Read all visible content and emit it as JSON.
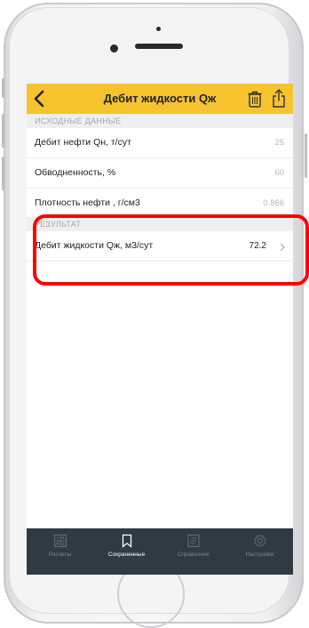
{
  "header": {
    "title": "Дебит жидкости Qж",
    "back_icon": "chevron-left-icon",
    "trash_icon": "trash-icon",
    "share_icon": "share-icon"
  },
  "sections": {
    "input_header": "ИСХОДНЫЕ ДАННЫЕ",
    "result_header": "РЕЗУЛЬТАТ"
  },
  "inputs": [
    {
      "label": "Дебит нефти Qн, т/сут",
      "value": "25"
    },
    {
      "label": "Обводненность, %",
      "value": "60"
    },
    {
      "label": "Плотность нефти , г/см3",
      "value": "0.866"
    }
  ],
  "result": {
    "label": "Дебит жидкости Qж, м3/сут",
    "value": "72.2"
  },
  "tabs": [
    {
      "label": "Расчеты",
      "icon": "calculator-icon",
      "active": false
    },
    {
      "label": "Сохраненные",
      "icon": "bookmark-icon",
      "active": true
    },
    {
      "label": "Справочник",
      "icon": "book-icon",
      "active": false
    },
    {
      "label": "Настройки",
      "icon": "gear-icon",
      "active": false
    }
  ],
  "colors": {
    "navbar": "#f7c32e",
    "tabbar": "#2f3a42",
    "annotation": "#ff0000"
  }
}
